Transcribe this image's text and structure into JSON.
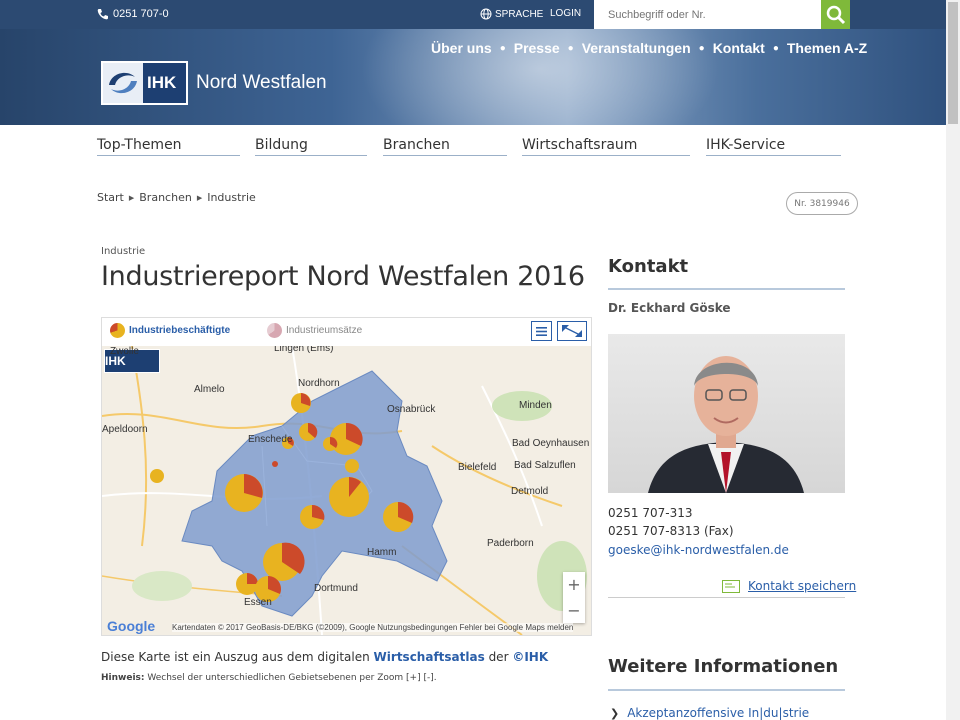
{
  "topbar": {
    "phone": "0251 707-0",
    "language": "SPRACHE",
    "login": "LOGIN",
    "search_placeholder": "Suchbegriff oder Nr."
  },
  "header": {
    "logo_abbr": "IHK",
    "logo_name": "Nord Westfalen",
    "nav": [
      "Über uns",
      "Presse",
      "Veranstaltungen",
      "Kontakt",
      "Themen A-Z"
    ]
  },
  "mainnav": [
    "Top-Themen",
    "Bildung",
    "Branchen",
    "Wirtschaftsraum",
    "IHK-Service"
  ],
  "breadcrumb": [
    "Start",
    "Branchen",
    "Industrie"
  ],
  "doc_number": "Nr. 3819946",
  "article": {
    "kicker": "Industrie",
    "title": "Industriereport Nord Westfalen 2016",
    "caption_prefix": "Diese Karte ist ein Auszug aus dem digitalen",
    "caption_link": "Wirtschaftsatlas",
    "caption_mid": "der",
    "caption_link2": "©IHK",
    "hint_label": "Hinweis:",
    "hint_text": "Wechsel der unterschiedlichen Gebietsebenen per Zoom [+] [-]."
  },
  "map": {
    "tab_active": "Industriebeschäftigte",
    "tab_inactive": "Industrieumsätze",
    "labels": [
      "Zwolle",
      "Lingen (Ems)",
      "Almelo",
      "Nordhorn",
      "Enschede",
      "Osnabrück",
      "Minden",
      "Bad Oeynhausen",
      "Bad Salzuflen",
      "Bielefeld",
      "Detmold",
      "Paderborn",
      "Hamm",
      "Dortmund",
      "Essen",
      "Apeldoorn"
    ],
    "credits": "Kartendaten © 2017 GeoBasis-DE/BKG (©2009), Google    Nutzungsbedingungen    Fehler bei Google Maps melden",
    "google": "Google",
    "colors": {
      "primary": "#e8b320",
      "secondary": "#cc4a2a",
      "region": "#7f9ccf"
    }
  },
  "contact": {
    "heading": "Kontakt",
    "name": "Dr. Eckhard Göske",
    "phone": "0251 707-313",
    "fax": "0251 707-8313 (Fax)",
    "email": "goeske@ihk-nordwestfalen.de",
    "save": "Kontakt speichern"
  },
  "more": {
    "heading": "Weitere Informationen",
    "link": "Akzeptanzoffensive In|du|strie"
  },
  "colors": {
    "brand": "#2c4a72",
    "accent": "#7fb93a",
    "link": "#2a5ea8"
  }
}
